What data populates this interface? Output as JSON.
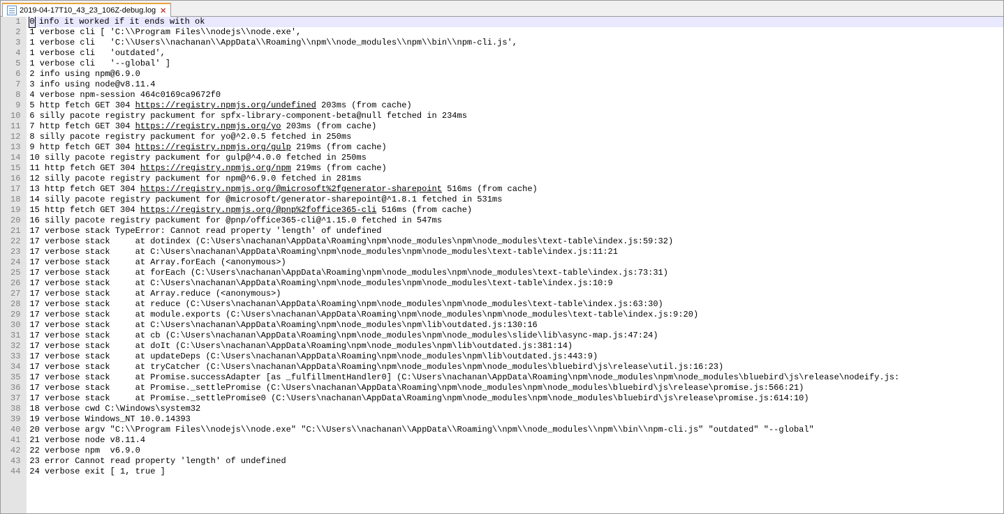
{
  "tab": {
    "filename": "2019-04-17T10_43_23_106Z-debug.log",
    "close_glyph": "✕"
  },
  "editor": {
    "current_line_index": 0,
    "lines": [
      {
        "n": 1,
        "segs": [
          {
            "t": "0 info it worked if it ends with ok",
            "cursorFirst": true
          }
        ]
      },
      {
        "n": 2,
        "segs": [
          {
            "t": "1 verbose cli [ 'C:\\\\Program Files\\\\nodejs\\\\node.exe',"
          }
        ]
      },
      {
        "n": 3,
        "segs": [
          {
            "t": "1 verbose cli   'C:\\\\Users\\\\nachanan\\\\AppData\\\\Roaming\\\\npm\\\\node_modules\\\\npm\\\\bin\\\\npm-cli.js',"
          }
        ]
      },
      {
        "n": 4,
        "segs": [
          {
            "t": "1 verbose cli   'outdated',"
          }
        ]
      },
      {
        "n": 5,
        "segs": [
          {
            "t": "1 verbose cli   '--global' ]"
          }
        ]
      },
      {
        "n": 6,
        "segs": [
          {
            "t": "2 info using npm@6.9.0"
          }
        ]
      },
      {
        "n": 7,
        "segs": [
          {
            "t": "3 info using node@v8.11.4"
          }
        ]
      },
      {
        "n": 8,
        "segs": [
          {
            "t": "4 verbose npm-session 464c0169ca9672f0"
          }
        ]
      },
      {
        "n": 9,
        "segs": [
          {
            "t": "5 http fetch GET 304 "
          },
          {
            "t": "https://registry.npmjs.org/undefined",
            "url": true
          },
          {
            "t": " 203ms (from cache)"
          }
        ]
      },
      {
        "n": 10,
        "segs": [
          {
            "t": "6 silly pacote registry packument for spfx-library-component-beta@null fetched in 234ms"
          }
        ]
      },
      {
        "n": 11,
        "segs": [
          {
            "t": "7 http fetch GET 304 "
          },
          {
            "t": "https://registry.npmjs.org/yo",
            "url": true
          },
          {
            "t": " 203ms (from cache)"
          }
        ]
      },
      {
        "n": 12,
        "segs": [
          {
            "t": "8 silly pacote registry packument for yo@^2.0.5 fetched in 250ms"
          }
        ]
      },
      {
        "n": 13,
        "segs": [
          {
            "t": "9 http fetch GET 304 "
          },
          {
            "t": "https://registry.npmjs.org/gulp",
            "url": true
          },
          {
            "t": " 219ms (from cache)"
          }
        ]
      },
      {
        "n": 14,
        "segs": [
          {
            "t": "10 silly pacote registry packument for gulp@^4.0.0 fetched in 250ms"
          }
        ]
      },
      {
        "n": 15,
        "segs": [
          {
            "t": "11 http fetch GET 304 "
          },
          {
            "t": "https://registry.npmjs.org/npm",
            "url": true
          },
          {
            "t": " 219ms (from cache)"
          }
        ]
      },
      {
        "n": 16,
        "segs": [
          {
            "t": "12 silly pacote registry packument for npm@^6.9.0 fetched in 281ms"
          }
        ]
      },
      {
        "n": 17,
        "segs": [
          {
            "t": "13 http fetch GET 304 "
          },
          {
            "t": "https://registry.npmjs.org/@microsoft%2fgenerator-sharepoint",
            "url": true
          },
          {
            "t": " 516ms (from cache)"
          }
        ]
      },
      {
        "n": 18,
        "segs": [
          {
            "t": "14 silly pacote registry packument for @microsoft/generator-sharepoint@^1.8.1 fetched in 531ms"
          }
        ]
      },
      {
        "n": 19,
        "segs": [
          {
            "t": "15 http fetch GET 304 "
          },
          {
            "t": "https://registry.npmjs.org/@pnp%2foffice365-cli",
            "url": true
          },
          {
            "t": " 516ms (from cache)"
          }
        ]
      },
      {
        "n": 20,
        "segs": [
          {
            "t": "16 silly pacote registry packument for @pnp/office365-cli@^1.15.0 fetched in 547ms"
          }
        ]
      },
      {
        "n": 21,
        "segs": [
          {
            "t": "17 verbose stack TypeError: Cannot read property 'length' of undefined"
          }
        ]
      },
      {
        "n": 22,
        "segs": [
          {
            "t": "17 verbose stack     at dotindex (C:\\Users\\nachanan\\AppData\\Roaming\\npm\\node_modules\\npm\\node_modules\\text-table\\index.js:59:32)"
          }
        ]
      },
      {
        "n": 23,
        "segs": [
          {
            "t": "17 verbose stack     at C:\\Users\\nachanan\\AppData\\Roaming\\npm\\node_modules\\npm\\node_modules\\text-table\\index.js:11:21"
          }
        ]
      },
      {
        "n": 24,
        "segs": [
          {
            "t": "17 verbose stack     at Array.forEach (<anonymous>)"
          }
        ]
      },
      {
        "n": 25,
        "segs": [
          {
            "t": "17 verbose stack     at forEach (C:\\Users\\nachanan\\AppData\\Roaming\\npm\\node_modules\\npm\\node_modules\\text-table\\index.js:73:31)"
          }
        ]
      },
      {
        "n": 26,
        "segs": [
          {
            "t": "17 verbose stack     at C:\\Users\\nachanan\\AppData\\Roaming\\npm\\node_modules\\npm\\node_modules\\text-table\\index.js:10:9"
          }
        ]
      },
      {
        "n": 27,
        "segs": [
          {
            "t": "17 verbose stack     at Array.reduce (<anonymous>)"
          }
        ]
      },
      {
        "n": 28,
        "segs": [
          {
            "t": "17 verbose stack     at reduce (C:\\Users\\nachanan\\AppData\\Roaming\\npm\\node_modules\\npm\\node_modules\\text-table\\index.js:63:30)"
          }
        ]
      },
      {
        "n": 29,
        "segs": [
          {
            "t": "17 verbose stack     at module.exports (C:\\Users\\nachanan\\AppData\\Roaming\\npm\\node_modules\\npm\\node_modules\\text-table\\index.js:9:20)"
          }
        ]
      },
      {
        "n": 30,
        "segs": [
          {
            "t": "17 verbose stack     at C:\\Users\\nachanan\\AppData\\Roaming\\npm\\node_modules\\npm\\lib\\outdated.js:130:16"
          }
        ]
      },
      {
        "n": 31,
        "segs": [
          {
            "t": "17 verbose stack     at cb (C:\\Users\\nachanan\\AppData\\Roaming\\npm\\node_modules\\npm\\node_modules\\slide\\lib\\async-map.js:47:24)"
          }
        ]
      },
      {
        "n": 32,
        "segs": [
          {
            "t": "17 verbose stack     at doIt (C:\\Users\\nachanan\\AppData\\Roaming\\npm\\node_modules\\npm\\lib\\outdated.js:381:14)"
          }
        ]
      },
      {
        "n": 33,
        "segs": [
          {
            "t": "17 verbose stack     at updateDeps (C:\\Users\\nachanan\\AppData\\Roaming\\npm\\node_modules\\npm\\lib\\outdated.js:443:9)"
          }
        ]
      },
      {
        "n": 34,
        "segs": [
          {
            "t": "17 verbose stack     at tryCatcher (C:\\Users\\nachanan\\AppData\\Roaming\\npm\\node_modules\\npm\\node_modules\\bluebird\\js\\release\\util.js:16:23)"
          }
        ]
      },
      {
        "n": 35,
        "segs": [
          {
            "t": "17 verbose stack     at Promise.successAdapter [as _fulfillmentHandler0] (C:\\Users\\nachanan\\AppData\\Roaming\\npm\\node_modules\\npm\\node_modules\\bluebird\\js\\release\\nodeify.js:"
          }
        ]
      },
      {
        "n": 36,
        "segs": [
          {
            "t": "17 verbose stack     at Promise._settlePromise (C:\\Users\\nachanan\\AppData\\Roaming\\npm\\node_modules\\npm\\node_modules\\bluebird\\js\\release\\promise.js:566:21)"
          }
        ]
      },
      {
        "n": 37,
        "segs": [
          {
            "t": "17 verbose stack     at Promise._settlePromise0 (C:\\Users\\nachanan\\AppData\\Roaming\\npm\\node_modules\\npm\\node_modules\\bluebird\\js\\release\\promise.js:614:10)"
          }
        ]
      },
      {
        "n": 38,
        "segs": [
          {
            "t": "18 verbose cwd C:\\Windows\\system32"
          }
        ]
      },
      {
        "n": 39,
        "segs": [
          {
            "t": "19 verbose Windows_NT 10.0.14393"
          }
        ]
      },
      {
        "n": 40,
        "segs": [
          {
            "t": "20 verbose argv \"C:\\\\Program Files\\\\nodejs\\\\node.exe\" \"C:\\\\Users\\\\nachanan\\\\AppData\\\\Roaming\\\\npm\\\\node_modules\\\\npm\\\\bin\\\\npm-cli.js\" \"outdated\" \"--global\""
          }
        ]
      },
      {
        "n": 41,
        "segs": [
          {
            "t": "21 verbose node v8.11.4"
          }
        ]
      },
      {
        "n": 42,
        "segs": [
          {
            "t": "22 verbose npm  v6.9.0"
          }
        ]
      },
      {
        "n": 43,
        "segs": [
          {
            "t": "23 error Cannot read property 'length' of undefined"
          }
        ]
      },
      {
        "n": 44,
        "segs": [
          {
            "t": "24 verbose exit [ 1, true ]"
          }
        ]
      }
    ]
  }
}
